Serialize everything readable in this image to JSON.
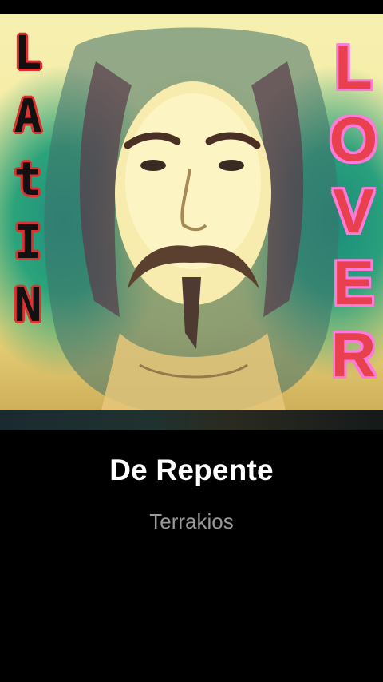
{
  "album_art": {
    "left_text_letters": [
      "L",
      "A",
      "t",
      "I",
      "N"
    ],
    "right_text_letters": [
      "L",
      "O",
      "V",
      "E",
      "R"
    ],
    "colors": {
      "left_letter_fill": "#111111",
      "left_letter_outline": "#e03030",
      "right_letter_fill": "#e8404e",
      "right_letter_outline": "#ff7ad9"
    }
  },
  "track": {
    "title": "De Repente",
    "artist": "Terrakios"
  },
  "theme": {
    "background": "#000000",
    "title_color": "#ffffff",
    "artist_color": "#9a9a9a"
  }
}
